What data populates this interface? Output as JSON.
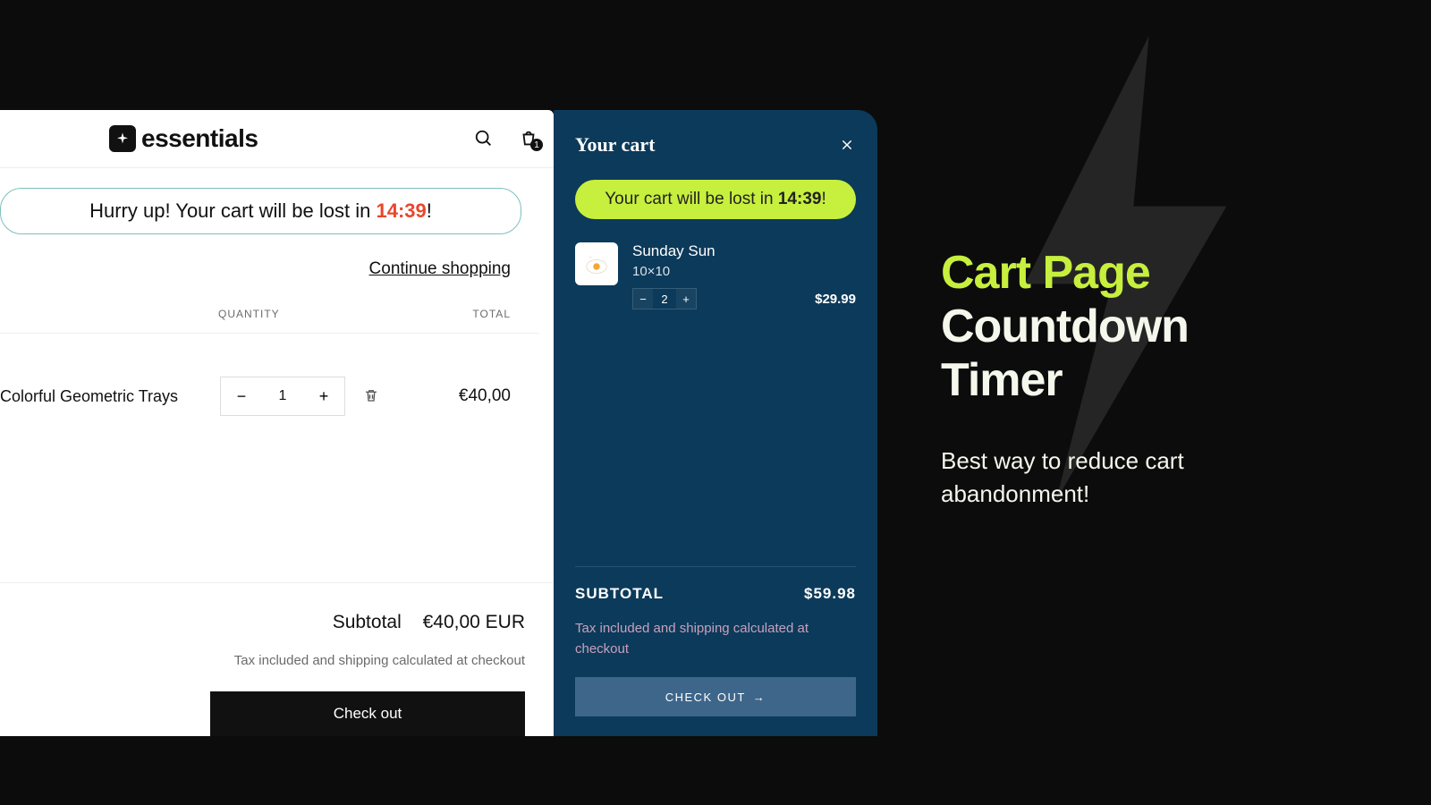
{
  "countdown": "14:39",
  "left": {
    "brand": "essentials",
    "cart_count": "1",
    "urgency_prefix": "Hurry up! Your cart will be lost in ",
    "urgency_suffix": "!",
    "continue_label": "Continue shopping",
    "col_quantity": "QUANTITY",
    "col_total": "TOTAL",
    "item": {
      "name": "Colorful Geometric Trays",
      "qty": "1",
      "price": "€40,00"
    },
    "subtotal_label": "Subtotal",
    "subtotal_value": "€40,00 EUR",
    "tax_note": "Tax included and shipping calculated at checkout",
    "checkout_label": "Check out"
  },
  "drawer": {
    "title": "Your cart",
    "urgency_prefix": "Your cart will be lost in ",
    "urgency_suffix": "!",
    "item": {
      "name": "Sunday Sun",
      "variant": "10×10",
      "qty": "2",
      "price": "$29.99"
    },
    "subtotal_label": "SUBTOTAL",
    "subtotal_value": "$59.98",
    "tax_note": "Tax included and shipping calculated at checkout",
    "checkout_label": "CHECK OUT"
  },
  "marketing": {
    "title_neon": "Cart Page",
    "title_rest": "Countdown Timer",
    "subtitle": "Best way to reduce cart abandonment!"
  }
}
